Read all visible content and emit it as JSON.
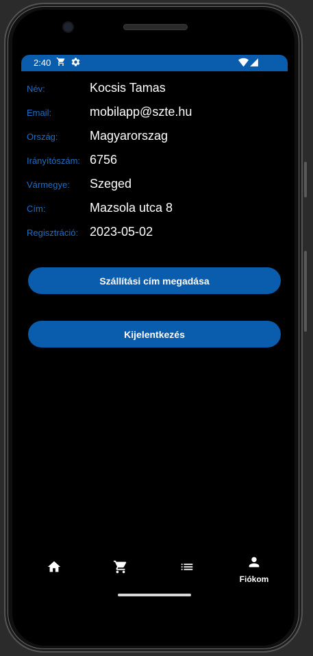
{
  "status_bar": {
    "time": "2:40",
    "color": "#0a5cad"
  },
  "profile": {
    "rows": [
      {
        "label": "Név:",
        "value": "Kocsis Tamas"
      },
      {
        "label": "Email:",
        "value": "mobilapp@szte.hu"
      },
      {
        "label": "Ország:",
        "value": "Magyarorszag"
      },
      {
        "label": "Irányítószám:",
        "value": "6756"
      },
      {
        "label": "Vármegye:",
        "value": "Szeged"
      },
      {
        "label": "Cím:",
        "value": "Mazsola utca 8"
      },
      {
        "label": "Regisztráció:",
        "value": "2023-05-02"
      }
    ]
  },
  "actions": {
    "shipping_label": "Szállítási cím megadása",
    "logout_label": "Kijelentkezés"
  },
  "nav": {
    "items": [
      {
        "icon": "home-icon",
        "label": ""
      },
      {
        "icon": "cart-icon",
        "label": ""
      },
      {
        "icon": "list-icon",
        "label": ""
      },
      {
        "icon": "person-icon",
        "label": "Fiókom"
      }
    ]
  },
  "colors": {
    "accent": "#0a5cad",
    "label": "#1f6fc5",
    "background": "#000000",
    "text": "#ffffff"
  }
}
